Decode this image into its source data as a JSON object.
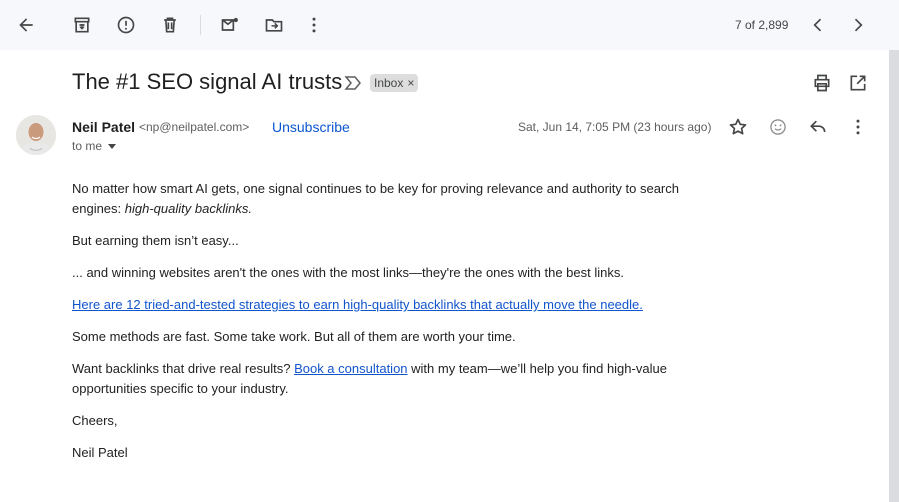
{
  "toolbar": {
    "back_icon": "arrow-left-icon",
    "archive_icon": "archive-icon",
    "report_icon": "report-spam-icon",
    "delete_icon": "trash-icon",
    "mark_unread_icon": "mark-unread-icon",
    "move_icon": "move-to-folder-icon",
    "more_icon": "more-vert-icon",
    "counter": "7 of 2,899",
    "prev_icon": "chevron-left-icon",
    "next_icon": "chevron-right-icon"
  },
  "email": {
    "subject": "The #1 SEO signal AI trusts",
    "label": "Inbox",
    "label_remove": "×",
    "sender_name": "Neil Patel",
    "sender_email": "<np@neilpatel.com>",
    "unsubscribe": "Unsubscribe",
    "to_me": "to me",
    "date": "Sat, Jun 14, 7:05 PM (23 hours ago)"
  },
  "body": {
    "p1_text": "No matter how smart AI gets, one signal continues to be key for proving relevance and authority to search engines: ",
    "p1_em": "high-quality backlinks.",
    "p2": "But earning them isn’t easy...",
    "p3": "... and winning websites aren't the ones with the most links—they're the ones with the best links.",
    "p4_link": "Here are 12 tried-and-tested strategies to earn high-quality backlinks that actually move the needle.",
    "p5": "Some methods are fast. Some take work. But all of them are worth your time.",
    "p6_before": "Want backlinks that drive real results? ",
    "p6_link": "Book a consultation",
    "p6_after": " with my team—we’ll help you find high-value opportunities specific to your industry.",
    "p7": "Cheers,",
    "p8": "Neil Patel"
  },
  "colors": {
    "toolbar_bg": "#f6f8fc",
    "link": "#1155cc",
    "unsubscribe": "#0b57d0",
    "chip_bg": "#dddddd"
  }
}
